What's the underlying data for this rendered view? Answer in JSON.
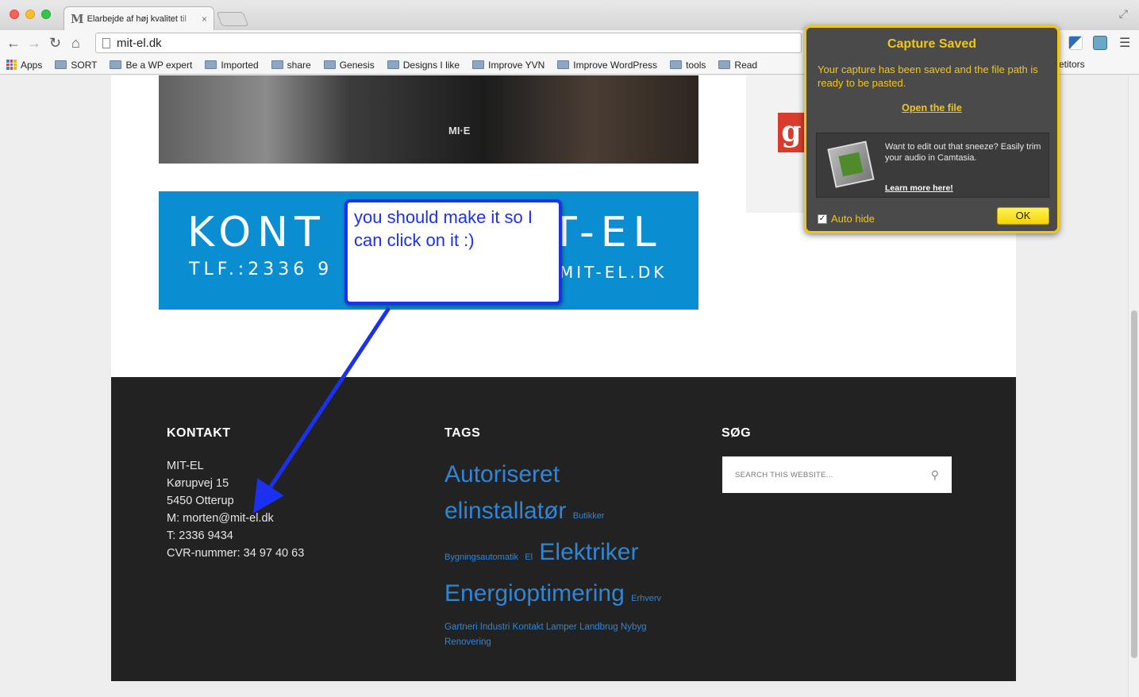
{
  "browser": {
    "tab_title": "Elarbejde af høj kvalitet til",
    "tab_favicon": "M",
    "url": "mit-el.dk",
    "bookmarks": [
      "Apps",
      "SORT",
      "Be a WP expert",
      "Imported",
      "share",
      "Genesis",
      "Designs I like",
      "Improve YVN",
      "Improve WordPress",
      "tools",
      "Read"
    ],
    "bookmark_overflow": "etitors"
  },
  "hero": {
    "logo_text": "MI·E"
  },
  "banner": {
    "title_left": "KONT",
    "title_right": "T-EL",
    "sub_left": "TLF.:2336 9",
    "sub_right": "MIT-EL.DK"
  },
  "annotation": {
    "text": "you should make it so I can click on it :)"
  },
  "footer": {
    "kontakt": {
      "title": "KONTAKT",
      "lines": [
        "MIT-EL",
        "Kørupvej 15",
        "5450 Otterup",
        "M: morten@mit-el.dk",
        "T: 2336 9434",
        "CVR-nummer: 34 97 40 63"
      ]
    },
    "tags": {
      "title": "TAGS",
      "items": [
        "Autoriseret elinstallatør",
        "Butikker",
        "Bygningsautomatik",
        "El",
        "Elektriker",
        "Energioptimering",
        "Erhverv",
        "Gartneri",
        "Industri",
        "Kontakt",
        "Lamper",
        "Landbrug",
        "Nybyg",
        "Renovering"
      ]
    },
    "search": {
      "title": "SØG",
      "placeholder": "SEARCH THIS WEBSITE..."
    }
  },
  "popup": {
    "title": "Capture Saved",
    "message": "Your capture has been saved and the file path is ready to be pasted.",
    "open_link": "Open the file",
    "promo_text": "Want to edit out that sneeze? Easily trim your audio in Camtasia.",
    "promo_link": "Learn more here!",
    "autohide_label": "Auto hide",
    "ok_label": "OK"
  },
  "colors": {
    "annotation_blue": "#1b30f0",
    "banner_blue": "#0a8ed1",
    "tag_blue": "#2f86d6",
    "popup_yellow": "#f3c711"
  }
}
